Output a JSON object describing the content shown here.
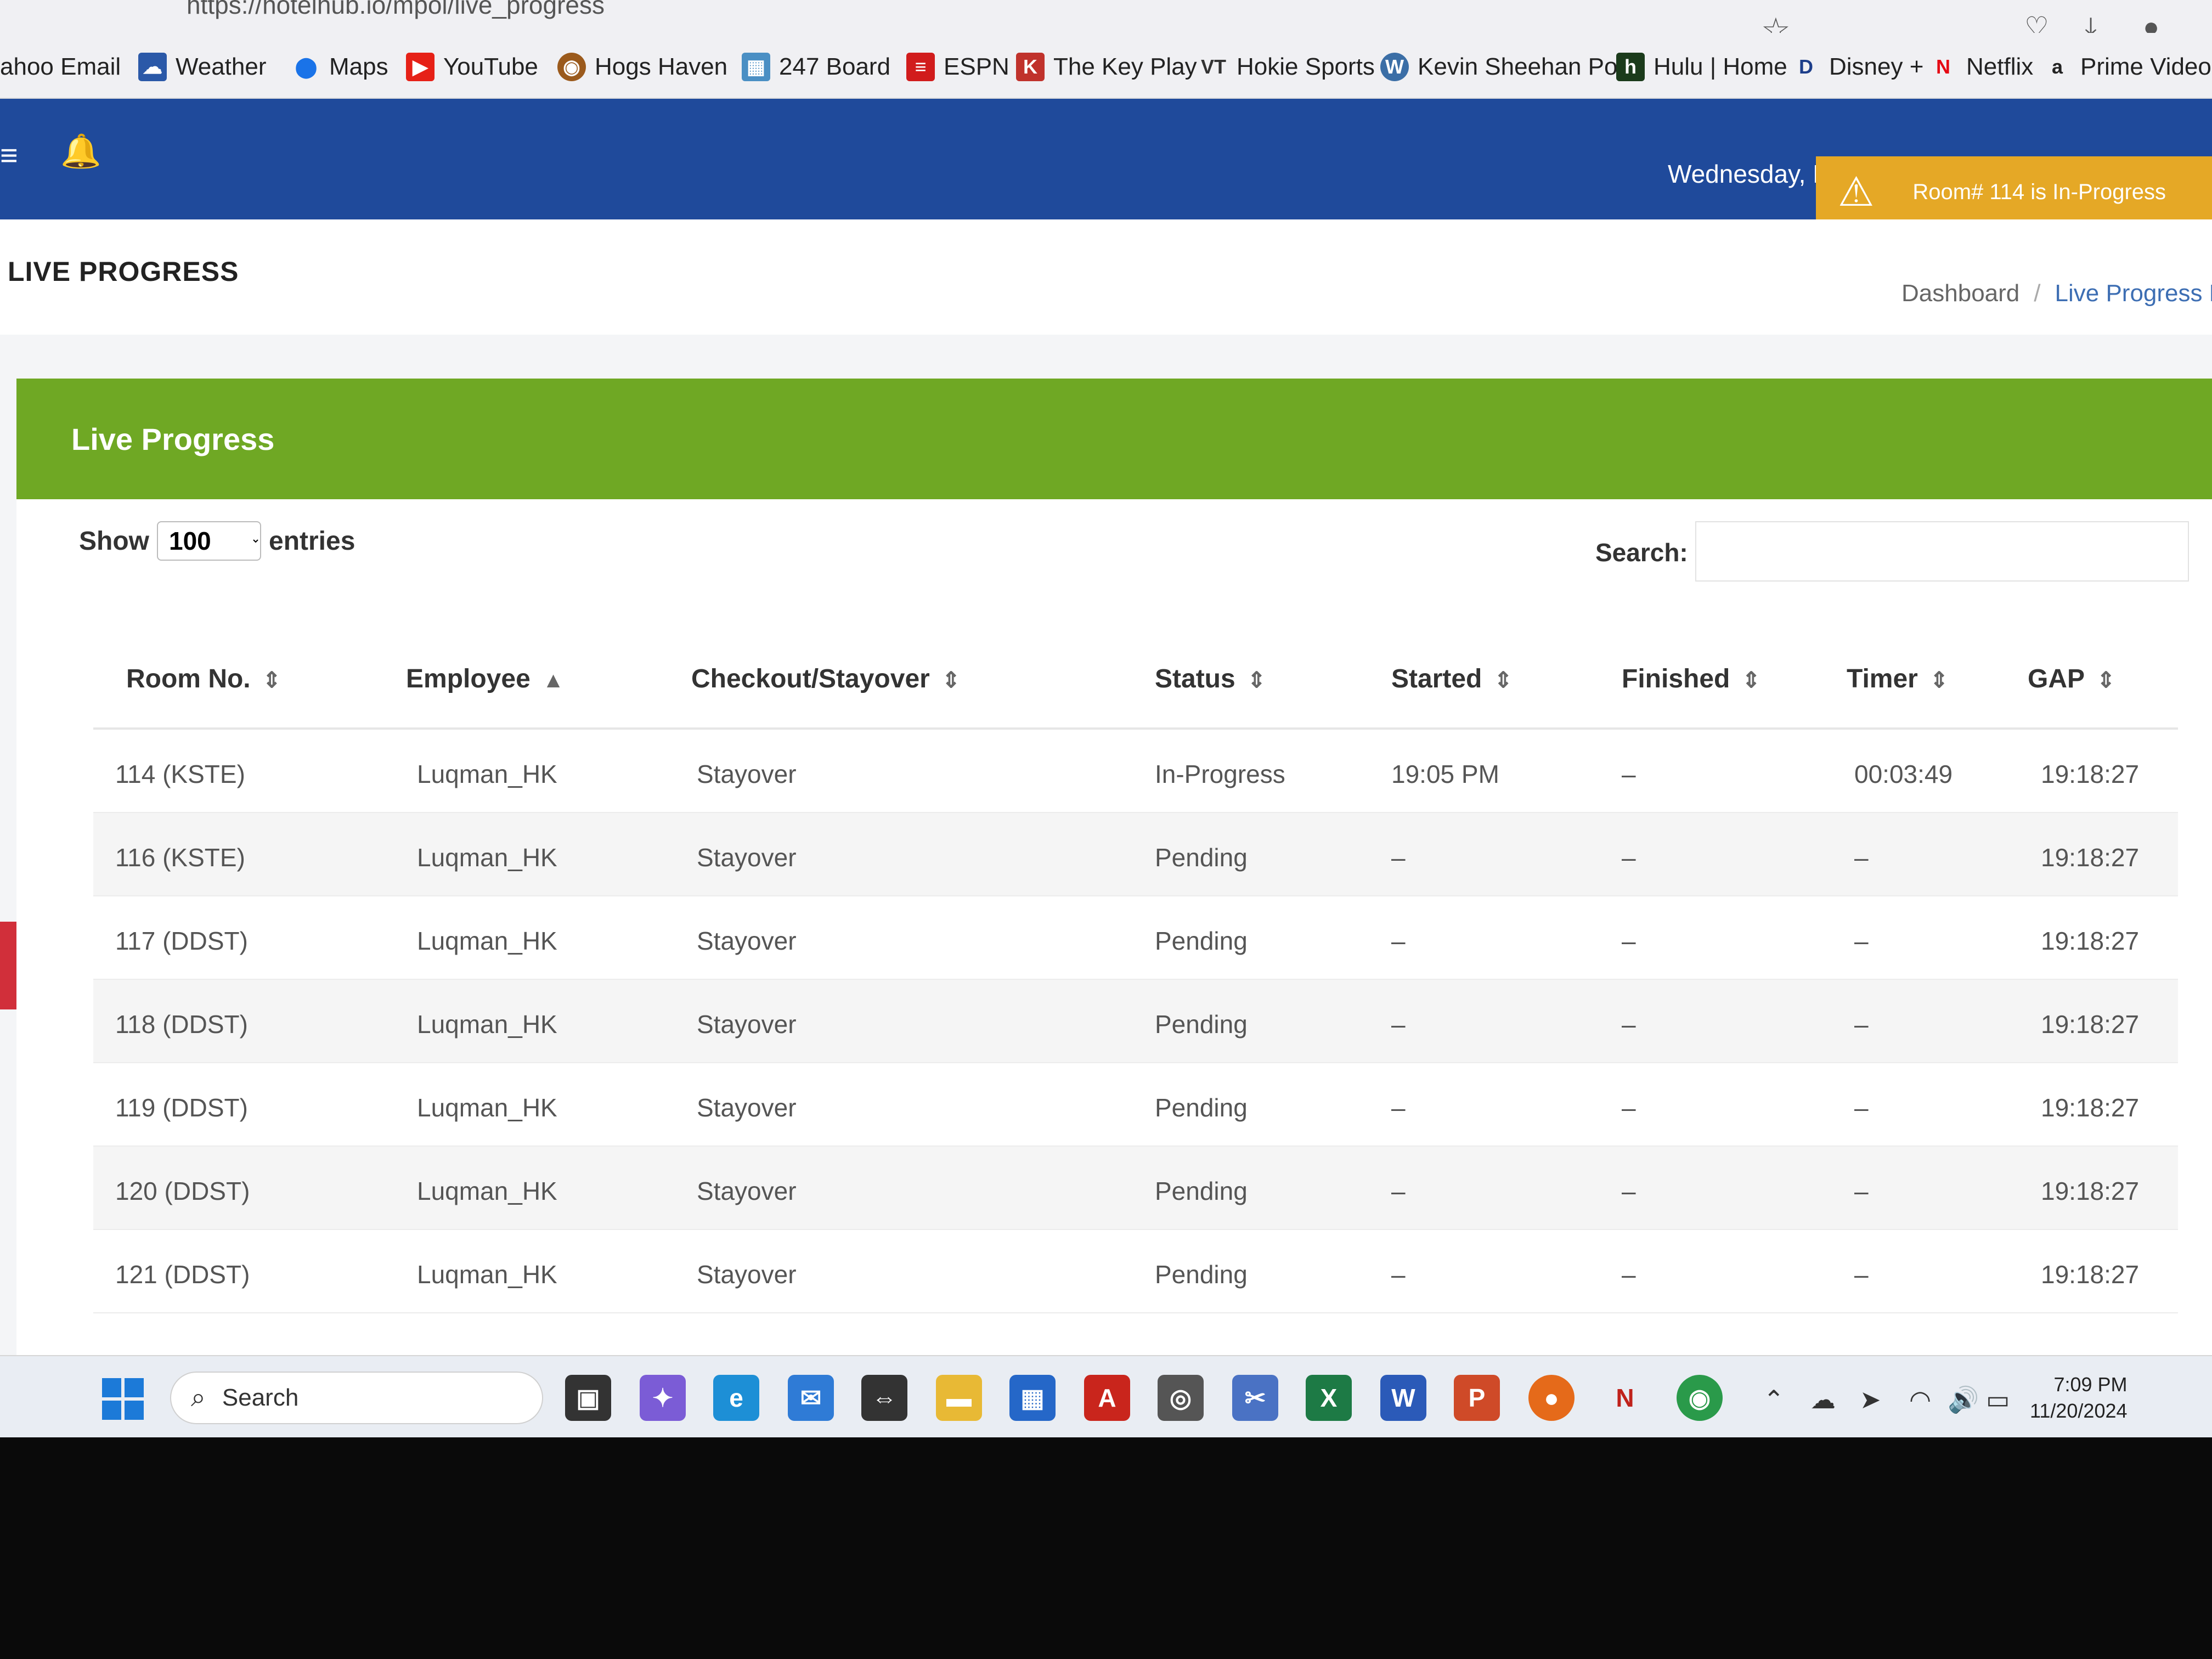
{
  "browser": {
    "url": "https://hotelhub.io/mpol/live_progress",
    "bookmarks": [
      {
        "label": "ahoo Email",
        "icon": ""
      },
      {
        "label": "Weather",
        "icon": "weather-icon"
      },
      {
        "label": "Maps",
        "icon": "maps-pin-icon"
      },
      {
        "label": "YouTube",
        "icon": "youtube-icon"
      },
      {
        "label": "Hogs Haven",
        "icon": "hogs-haven-icon"
      },
      {
        "label": "247 Board",
        "icon": "247-board-icon"
      },
      {
        "label": "ESPN",
        "icon": "espn-icon"
      },
      {
        "label": "The Key Play",
        "icon": "key-play-icon"
      },
      {
        "label": "Hokie Sports",
        "icon": "vt-icon"
      },
      {
        "label": "Kevin Sheehan Pod",
        "icon": "wordpress-icon"
      },
      {
        "label": "Hulu | Home",
        "icon": "hulu-icon"
      },
      {
        "label": "Disney +",
        "icon": "disney-icon"
      },
      {
        "label": "Netflix",
        "icon": "netflix-icon"
      },
      {
        "label": "Prime Video",
        "icon": "amazon-icon"
      }
    ]
  },
  "header": {
    "date": "Wednesday, N",
    "alert": "Room# 114 is In-Progress",
    "page_title": "LIVE PROGRESS",
    "breadcrumb": [
      "Dashboard",
      "Live Progress R"
    ]
  },
  "card": {
    "title": "Live Progress",
    "show_label": "Show",
    "show_value": "100",
    "entries_label": "entries",
    "search_label": "Search:"
  },
  "table": {
    "columns": [
      "Room No.",
      "Employee",
      "Checkout/Stayover",
      "Status",
      "Started",
      "Finished",
      "Timer",
      "GAP"
    ],
    "rows": [
      [
        "114 (KSTE)",
        "Luqman_HK",
        "Stayover",
        "In-Progress",
        "19:05 PM",
        "–",
        "00:03:49",
        "19:18:27"
      ],
      [
        "116 (KSTE)",
        "Luqman_HK",
        "Stayover",
        "Pending",
        "–",
        "–",
        "–",
        "19:18:27"
      ],
      [
        "117 (DDST)",
        "Luqman_HK",
        "Stayover",
        "Pending",
        "–",
        "–",
        "–",
        "19:18:27"
      ],
      [
        "118 (DDST)",
        "Luqman_HK",
        "Stayover",
        "Pending",
        "–",
        "–",
        "–",
        "19:18:27"
      ],
      [
        "119 (DDST)",
        "Luqman_HK",
        "Stayover",
        "Pending",
        "–",
        "–",
        "–",
        "19:18:27"
      ],
      [
        "120 (DDST)",
        "Luqman_HK",
        "Stayover",
        "Pending",
        "–",
        "–",
        "–",
        "19:18:27"
      ],
      [
        "121 (DDST)",
        "Luqman_HK",
        "Stayover",
        "Pending",
        "–",
        "–",
        "–",
        "19:18:27"
      ]
    ]
  },
  "taskbar": {
    "search": "Search",
    "time": "7:09 PM",
    "date": "11/20/2024"
  },
  "colors": {
    "header_blue": "#1f4a9b",
    "card_green": "#6fa824",
    "alert_orange": "#e5a826"
  }
}
